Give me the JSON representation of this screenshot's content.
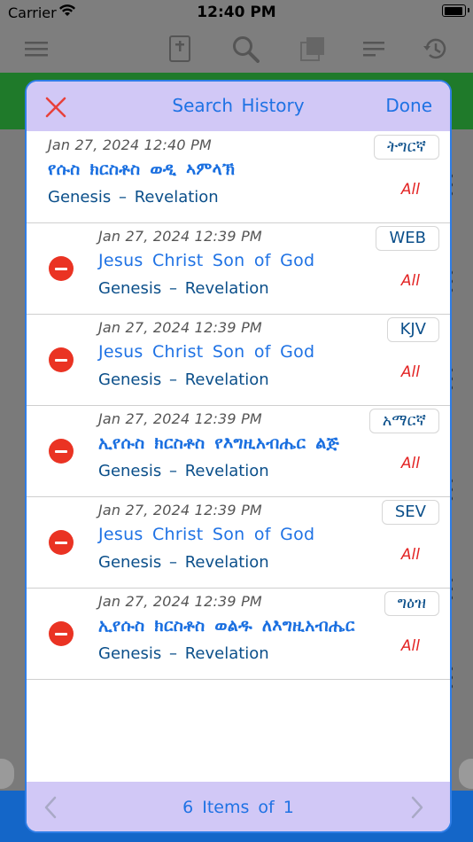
{
  "status_bar": {
    "carrier": "Carrier",
    "time": "12:40 PM"
  },
  "toolbar": {
    "icons": [
      "menu-icon",
      "bible-icon",
      "search-icon",
      "library-icon",
      "list-icon",
      "history-icon"
    ]
  },
  "modal": {
    "title": "Search History",
    "done_label": "Done",
    "close_icon": "close-x-icon",
    "footer": {
      "pagination_text": "6 Items of 1",
      "prev_icon": "chevron-left-icon",
      "next_icon": "chevron-right-icon"
    },
    "entries": [
      {
        "date": "Jan 27, 2024 12:40 PM",
        "version": "ትግርኛ",
        "query": "የሱስ ክርስቶስ ወዲ ኣምላኽ",
        "range": "Genesis – Revelation",
        "scope": "All",
        "ethiopic": true,
        "removable": false
      },
      {
        "date": "Jan 27, 2024 12:39 PM",
        "version": "WEB",
        "query": "Jesus Christ Son of God",
        "range": "Genesis – Revelation",
        "scope": "All",
        "ethiopic": false,
        "removable": true
      },
      {
        "date": "Jan 27, 2024 12:39 PM",
        "version": "KJV",
        "query": "Jesus Christ Son of God",
        "range": "Genesis – Revelation",
        "scope": "All",
        "ethiopic": false,
        "removable": true
      },
      {
        "date": "Jan 27, 2024 12:39 PM",
        "version": "አማርኛ",
        "query": "ኢየሱስ ክርስቶስ የእግዚአብሔር ልጅ",
        "range": "Genesis – Revelation",
        "scope": "All",
        "ethiopic": true,
        "removable": true
      },
      {
        "date": "Jan 27, 2024 12:39 PM",
        "version": "SEV",
        "query": "Jesus Christ Son of God",
        "range": "Genesis – Revelation",
        "scope": "All",
        "ethiopic": false,
        "removable": true
      },
      {
        "date": "Jan 27, 2024 12:39 PM",
        "version": "ግዕዝ",
        "query": "ኢየሱስ ክርስቶስ ወልዱ ለእግዚአብሔር",
        "range": "Genesis – Revelation",
        "scope": "All",
        "ethiopic": true,
        "removable": true
      }
    ]
  },
  "colors": {
    "accent": "#1f72e4",
    "header_bg": "#d1c8f6",
    "delete_red": "#ea3323",
    "scope_red": "#e32424",
    "range_blue": "#0b4f8a"
  }
}
